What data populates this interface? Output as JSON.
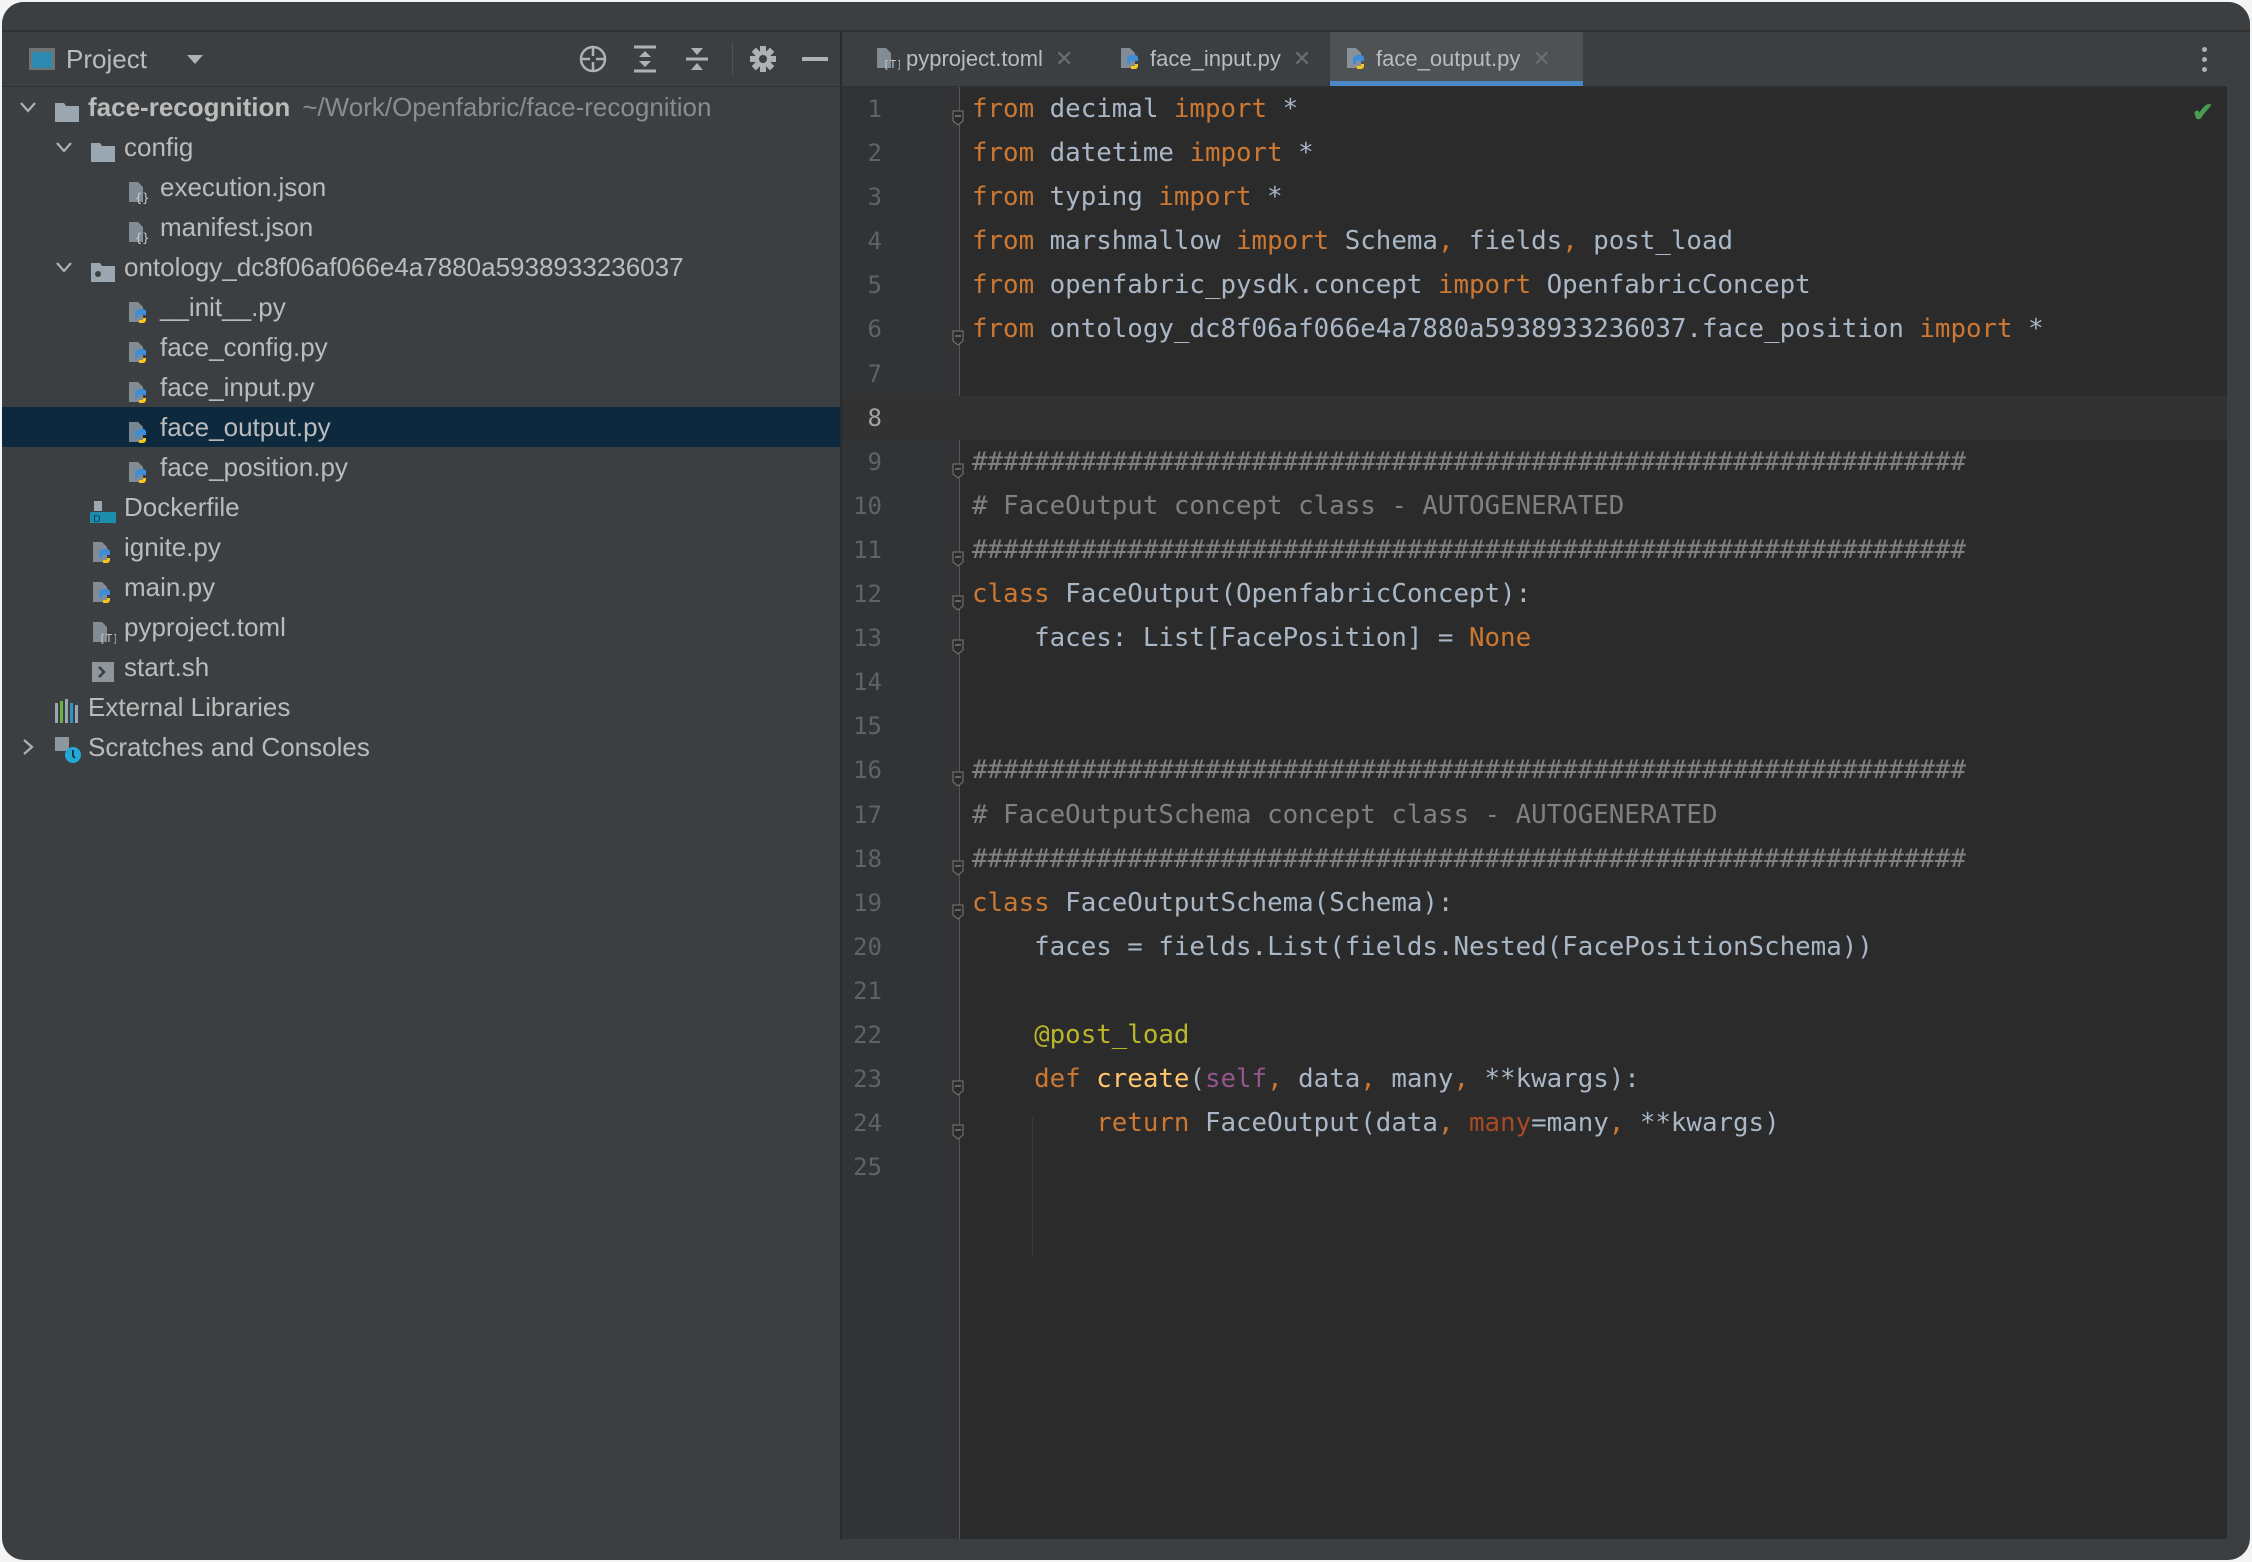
{
  "project_panel": {
    "title": "Project",
    "toolbar_icons": [
      "locate-icon",
      "expand-all-icon",
      "collapse-all-icon",
      "gear-icon",
      "minimize-icon"
    ],
    "tree": [
      {
        "label": "face-recognition",
        "hint": "~/Work/Openfabric/face-recognition",
        "level": 0,
        "type": "folder",
        "expanded": true,
        "bold": true
      },
      {
        "label": "config",
        "level": 1,
        "type": "folder",
        "expanded": true
      },
      {
        "label": "execution.json",
        "level": 2,
        "type": "json"
      },
      {
        "label": "manifest.json",
        "level": 2,
        "type": "json"
      },
      {
        "label": "ontology_dc8f06af066e4a7880a5938933236037",
        "level": 1,
        "type": "package",
        "expanded": true
      },
      {
        "label": "__init__.py",
        "level": 2,
        "type": "python"
      },
      {
        "label": "face_config.py",
        "level": 2,
        "type": "python"
      },
      {
        "label": "face_input.py",
        "level": 2,
        "type": "python"
      },
      {
        "label": "face_output.py",
        "level": 2,
        "type": "python",
        "selected": true
      },
      {
        "label": "face_position.py",
        "level": 2,
        "type": "python"
      },
      {
        "label": "Dockerfile",
        "level": 1,
        "type": "docker"
      },
      {
        "label": "ignite.py",
        "level": 1,
        "type": "python"
      },
      {
        "label": "main.py",
        "level": 1,
        "type": "python"
      },
      {
        "label": "pyproject.toml",
        "level": 1,
        "type": "toml"
      },
      {
        "label": "start.sh",
        "level": 1,
        "type": "shell"
      },
      {
        "label": "External Libraries",
        "level": 0,
        "type": "libraries"
      },
      {
        "label": "Scratches and Consoles",
        "level": 0,
        "type": "scratches",
        "expanded": false
      }
    ]
  },
  "tabs": [
    {
      "label": "pyproject.toml",
      "type": "toml",
      "active": false
    },
    {
      "label": "face_input.py",
      "type": "python",
      "active": false
    },
    {
      "label": "face_output.py",
      "type": "python",
      "active": true
    }
  ],
  "editor": {
    "current_line": 8,
    "status_icon": "check-icon",
    "status_color": "#499c54",
    "accent_color": "#4a88c7",
    "lines": [
      [
        [
          "kw",
          "from"
        ],
        [
          "tx",
          " decimal "
        ],
        [
          "kw",
          "import"
        ],
        [
          "tx",
          " *"
        ]
      ],
      [
        [
          "kw",
          "from"
        ],
        [
          "tx",
          " datetime "
        ],
        [
          "kw",
          "import"
        ],
        [
          "tx",
          " *"
        ]
      ],
      [
        [
          "kw",
          "from"
        ],
        [
          "tx",
          " typing "
        ],
        [
          "kw",
          "import"
        ],
        [
          "tx",
          " *"
        ]
      ],
      [
        [
          "kw",
          "from"
        ],
        [
          "tx",
          " marshmallow "
        ],
        [
          "kw",
          "import"
        ],
        [
          "tx",
          " Schema"
        ],
        [
          "kw",
          ","
        ],
        [
          "tx",
          " fields"
        ],
        [
          "kw",
          ","
        ],
        [
          "tx",
          " post_load"
        ]
      ],
      [
        [
          "kw",
          "from"
        ],
        [
          "tx",
          " openfabric_pysdk.concept "
        ],
        [
          "kw",
          "import"
        ],
        [
          "tx",
          " OpenfabricConcept"
        ]
      ],
      [
        [
          "kw",
          "from"
        ],
        [
          "tx",
          " ontology_dc8f06af066e4a7880a5938933236037.face_position "
        ],
        [
          "kw",
          "import"
        ],
        [
          "tx",
          " *"
        ]
      ],
      [],
      [],
      [
        [
          "cm",
          "################################################################"
        ]
      ],
      [
        [
          "cm",
          "# FaceOutput concept class - AUTOGENERATED"
        ]
      ],
      [
        [
          "cm",
          "################################################################"
        ]
      ],
      [
        [
          "kw",
          "class"
        ],
        [
          "tx",
          " FaceOutput(OpenfabricConcept):"
        ]
      ],
      [
        [
          "tx",
          "    faces: List[FacePosition] = "
        ],
        [
          "kw",
          "None"
        ]
      ],
      [],
      [],
      [
        [
          "cm",
          "################################################################"
        ]
      ],
      [
        [
          "cm",
          "# FaceOutputSchema concept class - AUTOGENERATED"
        ]
      ],
      [
        [
          "cm",
          "################################################################"
        ]
      ],
      [
        [
          "kw",
          "class"
        ],
        [
          "tx",
          " FaceOutputSchema(Schema):"
        ]
      ],
      [
        [
          "tx",
          "    faces = fields.List(fields.Nested(FacePositionSchema))"
        ]
      ],
      [],
      [
        [
          "dec",
          "    @post_load"
        ]
      ],
      [
        [
          "kw",
          "    def"
        ],
        [
          "fn",
          " create"
        ],
        [
          "tx",
          "("
        ],
        [
          "slf",
          "self"
        ],
        [
          "kw",
          ","
        ],
        [
          "tx",
          " data"
        ],
        [
          "kw",
          ","
        ],
        [
          "tx",
          " many"
        ],
        [
          "kw",
          ","
        ],
        [
          "tx",
          " **kwargs):"
        ]
      ],
      [
        [
          "kw",
          "        return"
        ],
        [
          "tx",
          " FaceOutput(data"
        ],
        [
          "kw",
          ","
        ],
        [
          "kwa",
          " many"
        ],
        [
          "tx",
          "=many"
        ],
        [
          "kw",
          ","
        ],
        [
          "tx",
          " **kwargs)"
        ]
      ],
      []
    ],
    "fold_markers": [
      1,
      6,
      9,
      11,
      12,
      13,
      16,
      18,
      19,
      23,
      24
    ]
  }
}
